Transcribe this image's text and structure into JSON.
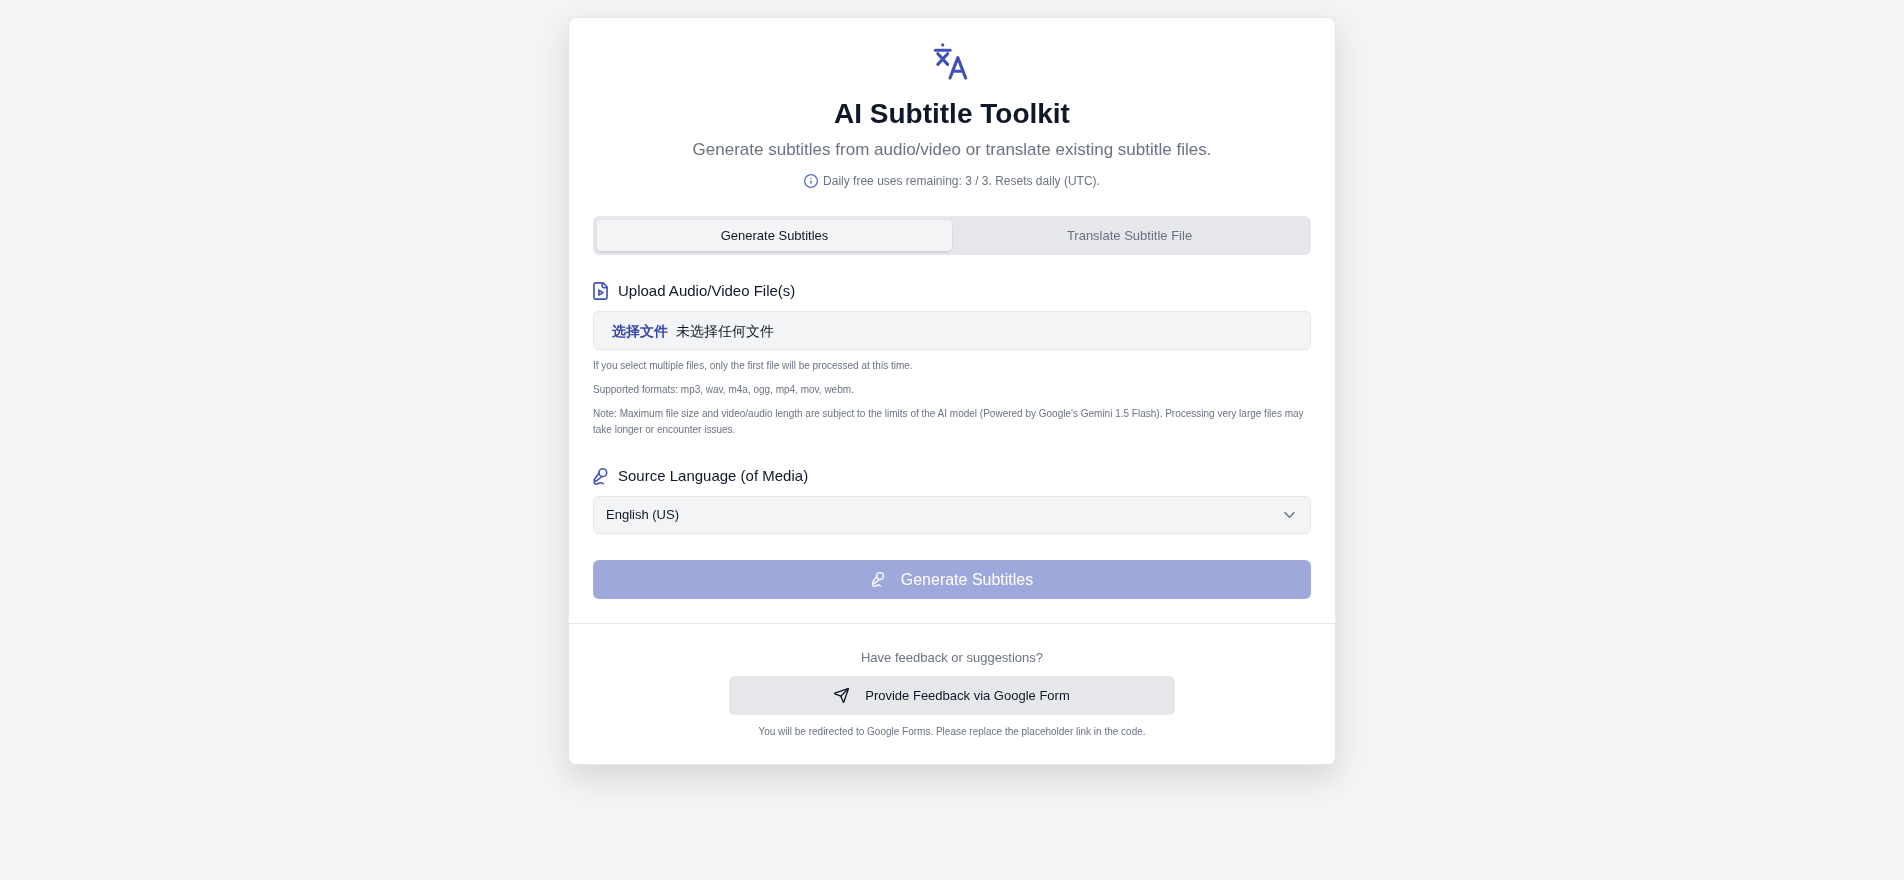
{
  "header": {
    "title": "AI Subtitle Toolkit",
    "subtitle": "Generate subtitles from audio/video or translate existing subtitle files.",
    "usage_note": "Daily free uses remaining: 3 / 3. Resets daily (UTC)."
  },
  "tabs": [
    {
      "label": "Generate Subtitles",
      "selected": true
    },
    {
      "label": "Translate Subtitle File",
      "selected": false
    }
  ],
  "upload": {
    "label": "Upload Audio/Video File(s)",
    "button": "选择文件",
    "value": "未选择任何文件",
    "notes": [
      "If you select multiple files, only the first file will be processed at this time.",
      "Supported formats: mp3, wav, m4a, ogg, mp4, mov, webm.",
      "Note: Maximum file size and video/audio length are subject to the limits of the AI model (Powered by Google's Gemini 1.5 Flash). Processing very large files may take longer or encounter issues."
    ]
  },
  "source_language": {
    "label": "Source Language (of Media)",
    "value": "English (US)"
  },
  "generate_button": {
    "label": "Generate Subtitles",
    "disabled": true
  },
  "feedback": {
    "prompt": "Have feedback or suggestions?",
    "button": "Provide Feedback via Google Form",
    "note": "You will be redirected to Google Forms. Please replace the placeholder link in the code."
  }
}
